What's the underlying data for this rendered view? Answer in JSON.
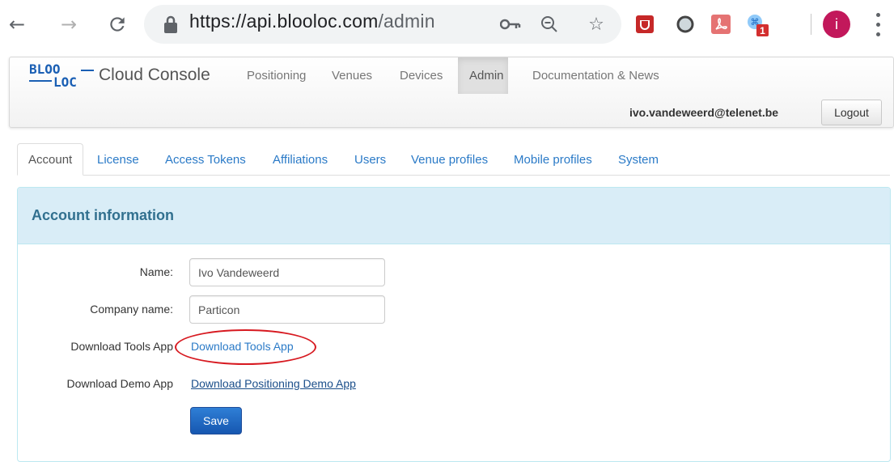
{
  "browser": {
    "url_host": "https://api.blooloc.com",
    "url_path": "/admin",
    "extension_badge": "1",
    "avatar_initial": "i",
    "icons": [
      "back-arrow-icon",
      "forward-arrow-icon",
      "reload-icon",
      "lock-icon",
      "key-icon",
      "zoom-out-icon",
      "star-icon",
      "shield-extension-icon",
      "circle-extension-icon",
      "pdf-extension-icon",
      "puzzle-extension-icon",
      "kebab-menu-icon"
    ]
  },
  "app": {
    "brand": "Cloud Console",
    "logo_text_top": "BLOO",
    "logo_text_bottom": "LOC",
    "nav": [
      "Positioning",
      "Venues",
      "Devices",
      "Admin",
      "Documentation & News"
    ],
    "active_nav": "Admin",
    "user_email": "ivo.vandeweerd@telenet.be",
    "logout_label": "Logout",
    "brand_color": "#1a5fb4"
  },
  "tabs": [
    "Account",
    "License",
    "Access Tokens",
    "Affiliations",
    "Users",
    "Venue profiles",
    "Mobile profiles",
    "System"
  ],
  "active_tab": "Account",
  "panel": {
    "title": "Account information",
    "name_label": "Name:",
    "name_value": "Ivo Vandeweerd",
    "company_label": "Company name:",
    "company_value": "Particon",
    "tools_label": "Download Tools App",
    "tools_link": "Download Tools App",
    "demo_label": "Download Demo App",
    "demo_link": "Download Positioning Demo App",
    "save_label": "Save",
    "highlight_color": "#d71920"
  }
}
